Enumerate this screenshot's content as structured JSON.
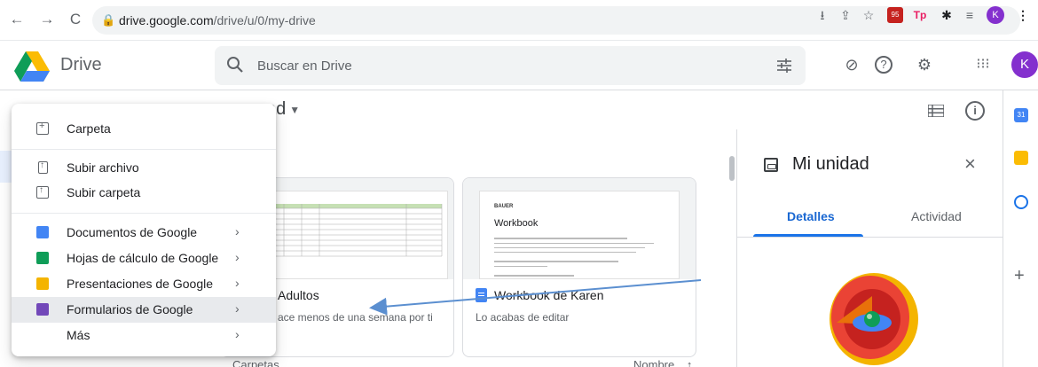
{
  "browser": {
    "url_host": "drive.google.com",
    "url_path": "/drive/u/0/my-drive",
    "extension_badge": "95",
    "ext_tp": "Tp",
    "profile_initial": "K"
  },
  "header": {
    "brand": "Drive",
    "search_placeholder": "Buscar en Drive",
    "avatar_initial": "K"
  },
  "main": {
    "crumb_fragment": "ad",
    "cards": [
      {
        "title": "Adultos",
        "subtitle": "ace menos de una semana por ti"
      },
      {
        "title": "Workbook de Karen",
        "subtitle": "Lo acabas de editar",
        "doc_heading": "Workbook",
        "doc_logo": "BAUER"
      }
    ],
    "bottom_left": "Carpetas",
    "bottom_right": "Nombre",
    "sort_arrow": "↑"
  },
  "details_panel": {
    "title": "Mi unidad",
    "close": "×",
    "tabs": [
      "Detalles",
      "Actividad"
    ]
  },
  "context_menu": {
    "items": [
      {
        "label": "Carpeta",
        "icon": "new-folder-icon"
      },
      {
        "label": "Subir archivo",
        "icon": "upload-file-icon"
      },
      {
        "label": "Subir carpeta",
        "icon": "upload-folder-icon"
      },
      {
        "label": "Documentos de Google",
        "icon": "google-docs-icon",
        "submenu": true,
        "color": "#4285f4"
      },
      {
        "label": "Hojas de cálculo de Google",
        "icon": "google-sheets-icon",
        "submenu": true,
        "color": "#0f9d58"
      },
      {
        "label": "Presentaciones de Google",
        "icon": "google-slides-icon",
        "submenu": true,
        "color": "#f4b400"
      },
      {
        "label": "Formularios de Google",
        "icon": "google-forms-icon",
        "submenu": true,
        "color": "#7248b9",
        "highlighted": true
      },
      {
        "label": "Más",
        "submenu": true
      }
    ],
    "submenu_arrow": "›"
  },
  "colors": {
    "accent": "#1a73e8",
    "avatar": "#8430ce",
    "annotation_arrow": "#5b8fd0"
  }
}
